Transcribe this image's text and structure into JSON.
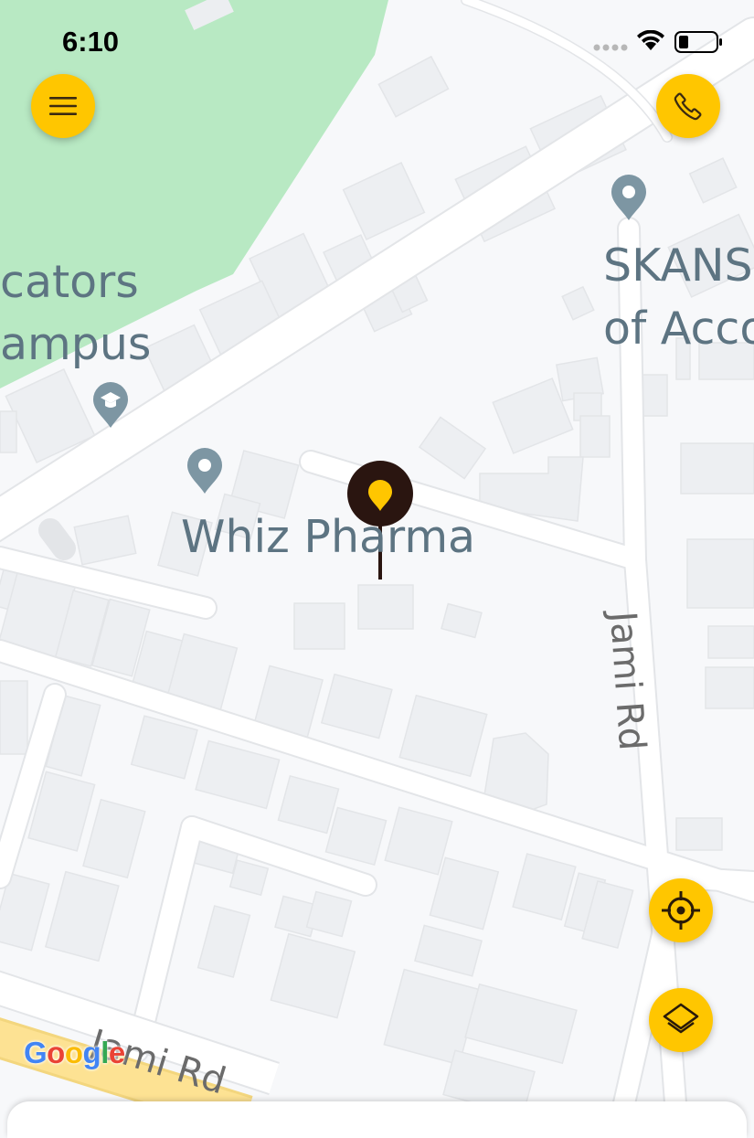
{
  "status_bar": {
    "time": "6:10"
  },
  "map": {
    "places": [
      {
        "name_line1": "cators",
        "name_line2": "ampus",
        "icon": "school-pin-icon"
      },
      {
        "name_line1": "SKANS",
        "name_line2": "of Acco",
        "icon": "location-pin-icon"
      },
      {
        "name": "Whiz Pharma",
        "icon": "location-pin-icon"
      }
    ],
    "roads": [
      "Jami Rd",
      "Jami Rd"
    ],
    "attribution": "Google",
    "selected_marker_icon": "map-pin-marker-icon"
  },
  "buttons": {
    "menu_icon": "hamburger-menu-icon",
    "call_icon": "phone-icon",
    "locate_icon": "crosshair-icon",
    "layers_icon": "layers-icon"
  },
  "colors": {
    "accent": "#ffc600",
    "marker": "#2a1510",
    "park": "#b8e9c3",
    "road_highlight": "#fde293"
  }
}
